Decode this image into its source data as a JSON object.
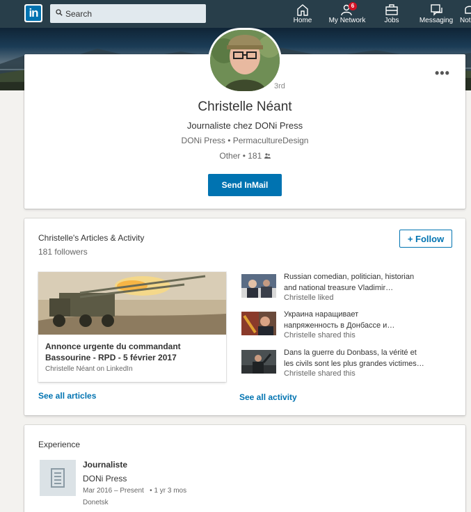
{
  "nav": {
    "logo_text": "in",
    "search_placeholder": "Search",
    "items": [
      {
        "label": "Home",
        "icon": "home-icon"
      },
      {
        "label": "My Network",
        "icon": "network-icon",
        "badge": "6"
      },
      {
        "label": "Jobs",
        "icon": "briefcase-icon"
      },
      {
        "label": "Messaging",
        "icon": "messaging-icon"
      },
      {
        "label": "Not",
        "icon": "bell-icon"
      }
    ]
  },
  "profile": {
    "degree": "3rd",
    "more": "•••",
    "name": "Christelle Néant",
    "headline": "Journaliste chez DONi Press",
    "companies": "DONi Press • PermacultureDesign",
    "location": "Other • 181 ",
    "connections_icon": "people-icon",
    "inmail_label": "Send InMail"
  },
  "activity": {
    "title": "Christelle's Articles & Activity",
    "followers": "181 followers",
    "follow_label": "+ Follow",
    "article": {
      "title": "Annonce urgente du commandant Bassourine - RPD - 5 février 2017",
      "meta": "Christelle Néant on LinkedIn"
    },
    "items": [
      {
        "line1": "Russian comedian, politician, historian",
        "line2": "and national treasure Vladimir…",
        "meta": "Christelle liked"
      },
      {
        "line1": "Украина наращивает",
        "line2": "напряженность в Донбассе и…",
        "meta": "Christelle shared this"
      },
      {
        "line1": "Dans la guerre du Donbass, la vérité et",
        "line2": "les civils sont les plus grandes victimes…",
        "meta": "Christelle shared this"
      }
    ],
    "see_articles": "See all articles",
    "see_activity": "See all activity"
  },
  "experience": {
    "title": "Experience",
    "role": "Journaliste",
    "company": "DONi Press",
    "dates": "Mar 2016 – Present   • 1 yr 3 mos",
    "location": "Donetsk"
  },
  "colors": {
    "nav_bg": "#283e4a",
    "accent": "#0073b1",
    "badge": "#d11124"
  }
}
